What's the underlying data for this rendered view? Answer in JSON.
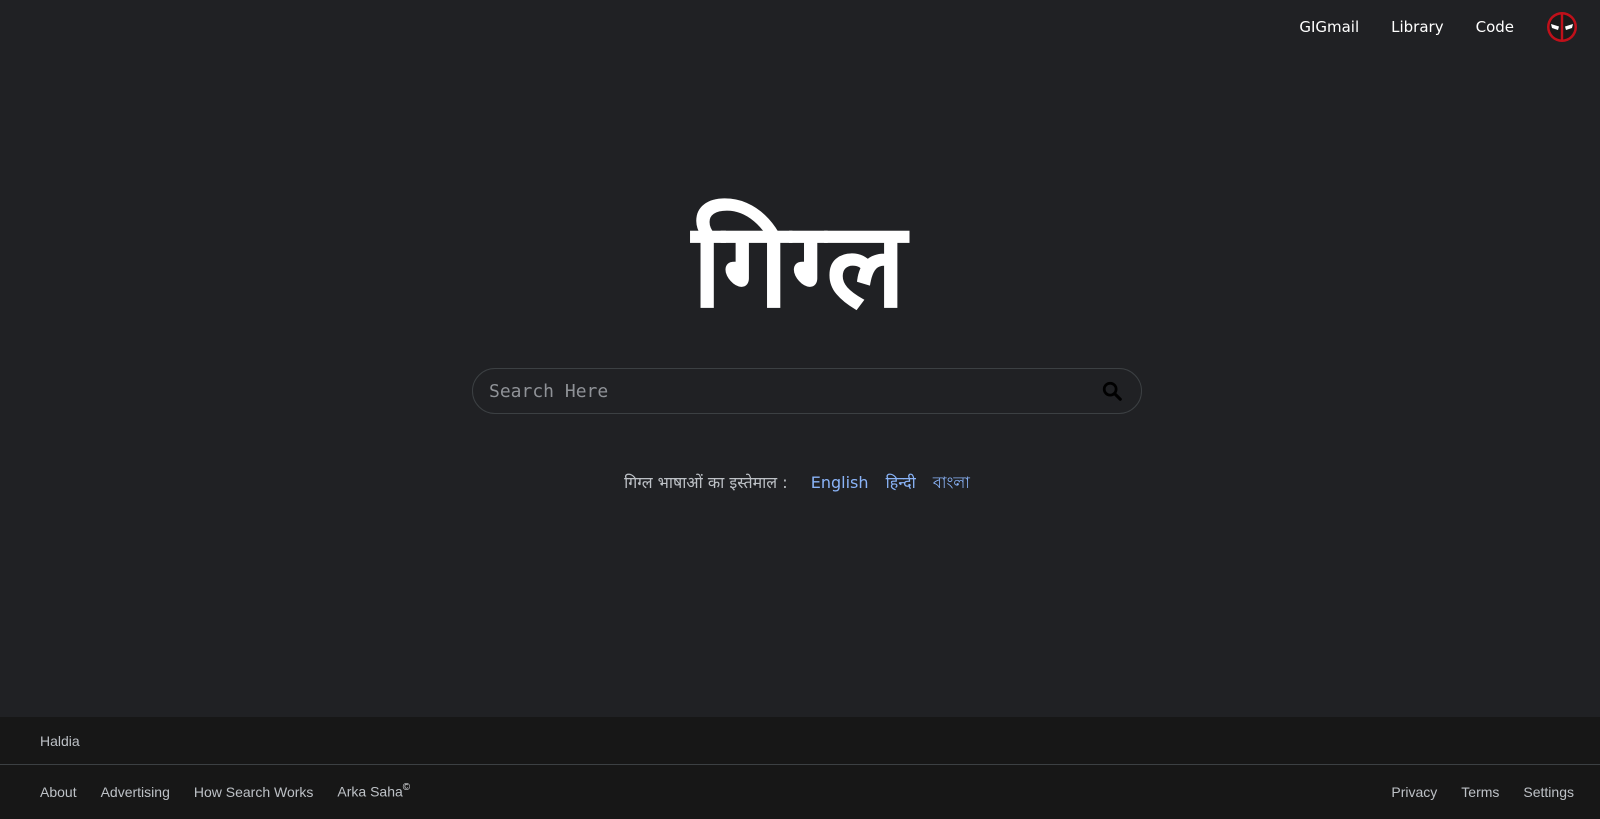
{
  "topnav": {
    "items": [
      {
        "label": "GIGmail"
      },
      {
        "label": "Library"
      },
      {
        "label": "Code"
      }
    ],
    "avatar_icon": "deadpool-mask-icon"
  },
  "logo": {
    "text": "गिग्ल"
  },
  "search": {
    "placeholder": "Search Here",
    "value": "",
    "button_icon": "search-icon"
  },
  "languages": {
    "lead": "गिग्ल भाषाओं का इस्तेमाल :",
    "options": [
      "English",
      "हिन्दी",
      "বাংলা"
    ]
  },
  "footer": {
    "location": "Haldia",
    "left_links": [
      "About",
      "Advertising",
      "How Search Works"
    ],
    "author": "Arka Saha",
    "copyright_mark": "©",
    "right_links": [
      "Privacy",
      "Terms",
      "Settings"
    ]
  },
  "colors": {
    "background": "#202124",
    "footer_background": "#171717",
    "link_accent": "#8ab4f8",
    "avatar_red": "#c0101a"
  }
}
